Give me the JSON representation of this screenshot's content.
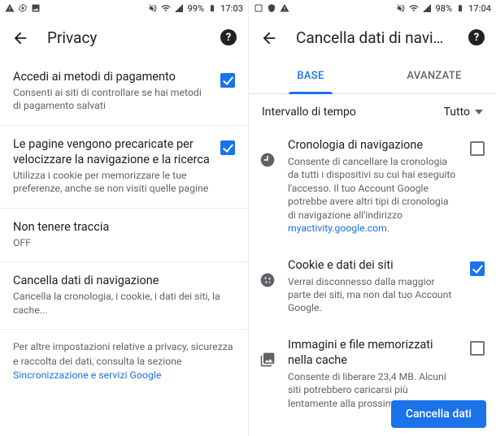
{
  "left": {
    "status": {
      "battery": "99%",
      "time": "17:03"
    },
    "header": {
      "title": "Privacy"
    },
    "items": [
      {
        "title": "Accedi ai metodi di pagamento",
        "sub": "Consenti ai siti di controllare se hai metodi di pagamento salvati",
        "checked": true
      },
      {
        "title": "Le pagine vengono precaricate per velocizzare la navigazione e la ricerca",
        "sub": "Utilizza i cookie per memorizzare le tue preferenze, anche se non visiti quelle pagine",
        "checked": true
      },
      {
        "title": "Non tenere traccia",
        "sub": "OFF",
        "checked": null
      },
      {
        "title": "Cancella dati di navigazione",
        "sub": "Cancella la cronologia, i cookie, i dati dei siti, la cache...",
        "checked": null
      }
    ],
    "footer": {
      "text": "Per altre impostazioni relative a privacy, sicurezza e raccolta dei dati, consulta la sezione ",
      "link": "Sincronizzazione e servizi Google"
    }
  },
  "right": {
    "status": {
      "battery": "98%",
      "time": "17:04"
    },
    "header": {
      "title": "Cancella dati di navig..."
    },
    "tabs": {
      "base": "BASE",
      "advanced": "AVANZATE"
    },
    "range": {
      "label": "Intervallo di tempo",
      "value": "Tutto"
    },
    "items": [
      {
        "title": "Cronologia di navigazione",
        "sub_before": "Consente di cancellare la cronologia da tutti i dispositivi su cui hai eseguito l'accesso. Il tuo Account Google potrebbe avere altri tipi di cronologia di navigazione all'indirizzo ",
        "link": "myactivity.google.com",
        "sub_after": ".",
        "checked": false
      },
      {
        "title": "Cookie e dati dei siti",
        "sub_before": "Verrai disconnesso dalla maggior parte dei siti, ma non dal tuo Account Google.",
        "link": "",
        "sub_after": "",
        "checked": true
      },
      {
        "title": "Immagini e file memorizzati nella cache",
        "sub_before": "Consente di liberare 23,4 MB. Alcuni siti potrebbero caricarsi più lentamente alla prossima visita.",
        "link": "",
        "sub_after": "",
        "checked": false
      }
    ],
    "button": "Cancella dati"
  }
}
